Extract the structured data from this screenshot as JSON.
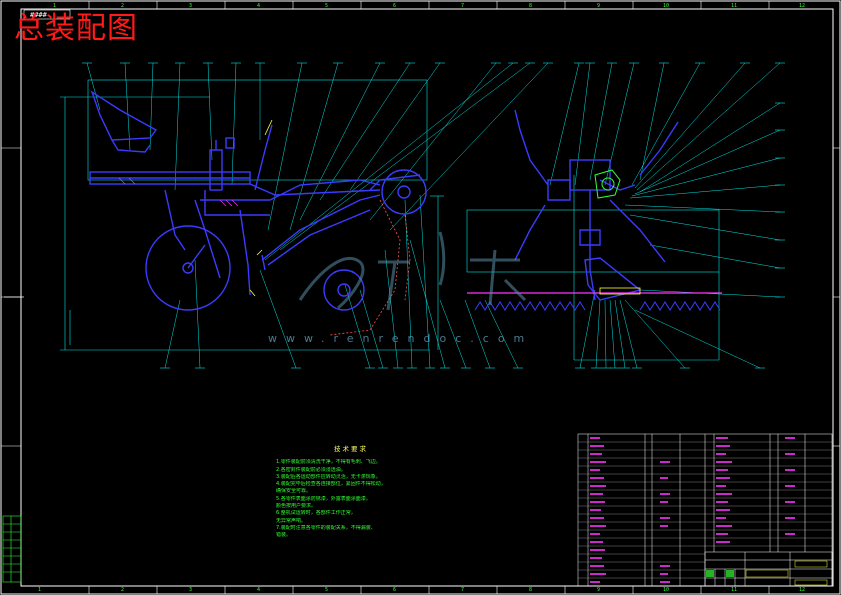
{
  "drawing": {
    "title": "总装配图",
    "tech_requirements": {
      "heading": "技术要求",
      "lines": [
        "1.零件装配前须清洗干净，不得有毛刺、飞边。",
        "2.各密封件装配前必须浸透油。",
        "3.装配后各运动部件应转动灵活，无卡滞现象。",
        "4.装配完毕后检查各连接部位，紧固件不得松动，",
        "   确保安全可靠。",
        "5.各零件表面涂防锈漆，外露表面涂面漆。",
        "   颜色按用户要求。",
        "6.整机试运转时，各部件工作正常，",
        "   无异常声响。",
        "7.装配时注意各零件的装配关系，不得漏装、",
        "   错装。"
      ]
    },
    "watermark": "www.renrendoc.com",
    "column_numbers": [
      "1",
      "2",
      "3",
      "4",
      "5",
      "6",
      "7",
      "8",
      "9",
      "10",
      "11",
      "12"
    ],
    "colors": {
      "frame": "#ffffff",
      "outline": "#00e5e5",
      "part": "#3b3bff",
      "leader": "#00e5e5",
      "hatch": "#ff33ff",
      "accent": "#33ff33",
      "title": "#ff1a1a",
      "chain": "#ff5555"
    }
  }
}
